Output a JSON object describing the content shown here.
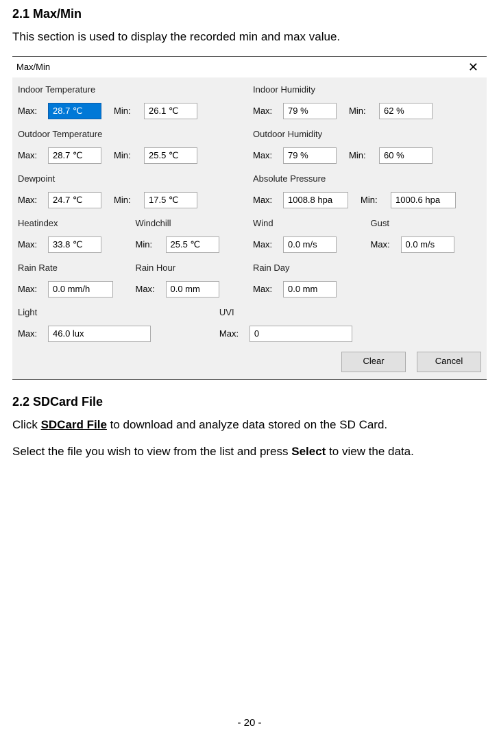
{
  "doc": {
    "heading1": "2.1 Max/Min",
    "intro1": "This section is used to display the recorded min and max value.",
    "heading2": "2.2 SDCard File",
    "para2_pre": "Click ",
    "para2_bold": "SDCard File",
    "para2_post": " to download and analyze data stored on the SD Card.",
    "para3_a": "Select the file you wish to view from the list and press ",
    "para3_b": "Select",
    "para3_c": " to view the data.",
    "page_num": "- 20 -"
  },
  "dlg": {
    "title": "Max/Min",
    "labels": {
      "max": "Max:",
      "min": "Min:"
    },
    "buttons": {
      "clear": "Clear",
      "cancel": "Cancel"
    },
    "groups": {
      "indoor_temp": {
        "title": "Indoor Temperature",
        "max": "28.7 ℃",
        "min": "26.1 ℃"
      },
      "indoor_hum": {
        "title": "Indoor Humidity",
        "max": "79 %",
        "min": "62 %"
      },
      "outdoor_temp": {
        "title": "Outdoor Temperature",
        "max": "28.7 ℃",
        "min": "25.5 ℃"
      },
      "outdoor_hum": {
        "title": "Outdoor Humidity",
        "max": "79 %",
        "min": "60 %"
      },
      "dewpoint": {
        "title": "Dewpoint",
        "max": "24.7 ℃",
        "min": "17.5 ℃"
      },
      "abs_press": {
        "title": "Absolute Pressure",
        "max": "1008.8 hpa",
        "min": "1000.6 hpa"
      },
      "heatindex": {
        "title": "Heatindex",
        "max": "33.8 ℃"
      },
      "windchill": {
        "title": "Windchill",
        "min": "25.5 ℃"
      },
      "wind": {
        "title": "Wind",
        "max": "0.0 m/s"
      },
      "gust": {
        "title": "Gust",
        "max": "0.0 m/s"
      },
      "rain_rate": {
        "title": "Rain Rate",
        "max": "0.0 mm/h"
      },
      "rain_hour": {
        "title": "Rain Hour",
        "max": "0.0 mm"
      },
      "rain_day": {
        "title": "Rain Day",
        "max": "0.0 mm"
      },
      "light": {
        "title": "Light",
        "max": "46.0 lux"
      },
      "uvi": {
        "title": "UVI",
        "max": "0"
      }
    }
  }
}
